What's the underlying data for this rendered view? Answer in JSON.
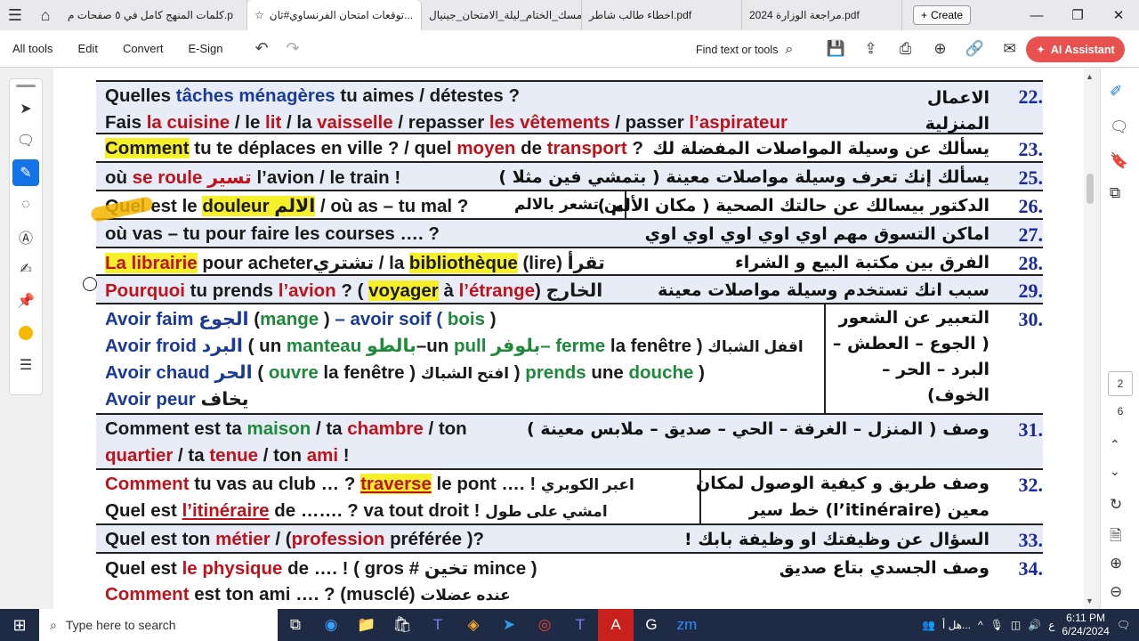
{
  "tabs": [
    {
      "label": "كلمات المنهج كامل في ٥ صفحات م.p",
      "active": false
    },
    {
      "label": "توقعات امتحان الفرنساوي#ثان...",
      "active": true
    },
    {
      "label": "مسك_الختام_ليلة_الامتحان_جينيال...",
      "active": false
    },
    {
      "label": "اخطاء طالب شاطر.pdf",
      "active": false
    },
    {
      "label": "مراجعة الوزارة 2024.pdf",
      "active": false
    }
  ],
  "create_label": "Create",
  "menu": {
    "all_tools": "All tools",
    "edit": "Edit",
    "convert": "Convert",
    "esign": "E-Sign"
  },
  "find_text": "Find text or tools",
  "ai_label": "AI Assistant",
  "rows": {
    "r22": {
      "num": "22.",
      "ar": "الاعمال المنزلية"
    },
    "r23": {
      "num": "23.",
      "ar": "يسألك عن وسيلة المواصلات المفضلة لك"
    },
    "r25": {
      "num": "25.",
      "ar": "يسألك إنك تعرف وسيلة مواصلات معينة ( بتمشي فين مثلا )"
    },
    "r26": {
      "num": "26.",
      "ar": "الدكتور بيسالك عن حالتك الصحية ( مكان الألم )",
      "mid": "اين تشعر بالالم"
    },
    "r27": {
      "num": "27.",
      "ar": "اماكن التسوق مهم اوي اوي اوي اوي اوي"
    },
    "r28": {
      "num": "28.",
      "ar": "الفرق بين مكتبة البيع و الشراء"
    },
    "r29": {
      "num": "29.",
      "ar": "سبب انك تستخدم وسيلة مواصلات معينة"
    },
    "r30": {
      "num": "30.",
      "ar1": "التعبير عن الشعور",
      "ar2": "( الجوع – العطش –",
      "ar3": "البرد – الحر –",
      "ar4": "الخوف)"
    },
    "r31": {
      "num": "31.",
      "ar": "وصف ( المنزل – الغرفة – الحي – صديق – ملابس معينة )"
    },
    "r32": {
      "num": "32.",
      "ar1": "وصف طريق و كيفية الوصول لمكان",
      "ar2": "معين (l’itinéraire) خط سير"
    },
    "r33": {
      "num": "33.",
      "ar": "السؤال عن وظيفتك او وظيفة بابك !"
    },
    "r34": {
      "num": "34.",
      "ar": "وصف الجسدي بتاع صديق"
    }
  },
  "fr": {
    "r22a": [
      "Quelles ",
      "tâches ménagères",
      " tu aimes / détestes ?"
    ],
    "r22b": [
      "Fais ",
      "la cuisine",
      " / le ",
      "lit",
      " / la ",
      "vaisselle",
      " / repasser ",
      "les vêtements",
      " / passer ",
      "l’aspirateur"
    ],
    "r23": [
      "Comment",
      " tu te déplaces en ville ? / quel ",
      "moyen",
      " de ",
      "transport",
      " ?"
    ],
    "r25": [
      "où ",
      "se roule",
      " تسير",
      " l’avion / le train !"
    ],
    "r26": [
      "Quel est le ",
      "douleur الالم",
      " / où as – tu mal ?"
    ],
    "r27": [
      "où vas – tu pour  faire les courses …. ?"
    ],
    "r28": [
      "La librairie",
      " pour acheter",
      "تشتري",
      " / la ",
      "bibliothèque",
      " (lire) ",
      "تقرأ"
    ],
    "r29": [
      "Pourquoi",
      " tu prends ",
      "l’avion",
      " ? ( ",
      "voyager",
      " à ",
      "l’étrange",
      ") ",
      "الخارج"
    ],
    "r30a": [
      "Avoir faim ",
      "الجوع",
      " (",
      "mange",
      " )",
      "        – avoir soif ( ",
      "bois",
      " )"
    ],
    "r30b": [
      "Avoir froid  ",
      "البرد",
      " ( un ",
      "manteau",
      " بالطو",
      "–un ",
      "pull",
      "   بلوفر–",
      " ferme",
      " la fenêtre  ) ",
      "اقفل الشباك"
    ],
    "r30c": [
      "Avoir chaud ",
      "الحر",
      " ( ",
      "ouvre",
      " la fenêtre ) ",
      "افتح الشباك",
      " ) ",
      "prends",
      " une ",
      "douche",
      " )"
    ],
    "r30d": [
      "Avoir peur  ",
      "يخاف"
    ],
    "r31a": [
      "Comment est ta ",
      "maison",
      " / ta ",
      "chambre",
      " / ton"
    ],
    "r31b": [
      "quartier",
      " / ta ",
      "tenue",
      " / ton ",
      "ami",
      " !"
    ],
    "r32a": [
      "Comment",
      " tu vas au club … ?  ",
      "traverse",
      " le pont …. !  ",
      "اعبر الكوبري"
    ],
    "r32b": [
      "Quel est ",
      "l’itinéraire",
      " de ……. ?  va tout droit  !  ",
      "امشي على طول"
    ],
    "r33": [
      "Quel est ton ",
      "métier",
      " / (",
      "profession",
      " préférée )?"
    ],
    "r34a": [
      "Quel est ",
      "le physique",
      " de …. !  (  gros  ",
      "# تخين",
      " mince )"
    ],
    "r34b": [
      "Comment",
      " est ton ami …. ?    (musclé) ",
      "عنده عضلات"
    ]
  },
  "page": {
    "current": "2",
    "total": "6"
  },
  "taskbar": {
    "search_placeholder": "Type here to search",
    "time": "6:11 PM",
    "date": "6/24/2024",
    "lang": "ع",
    "weather": "هل أ..."
  },
  "colors": {
    "red": "#c0121a",
    "green": "#1c8a3a",
    "highlight": "#f6f02a",
    "number_blue": "#1a2a9a",
    "ai_button": "#e8524e"
  }
}
